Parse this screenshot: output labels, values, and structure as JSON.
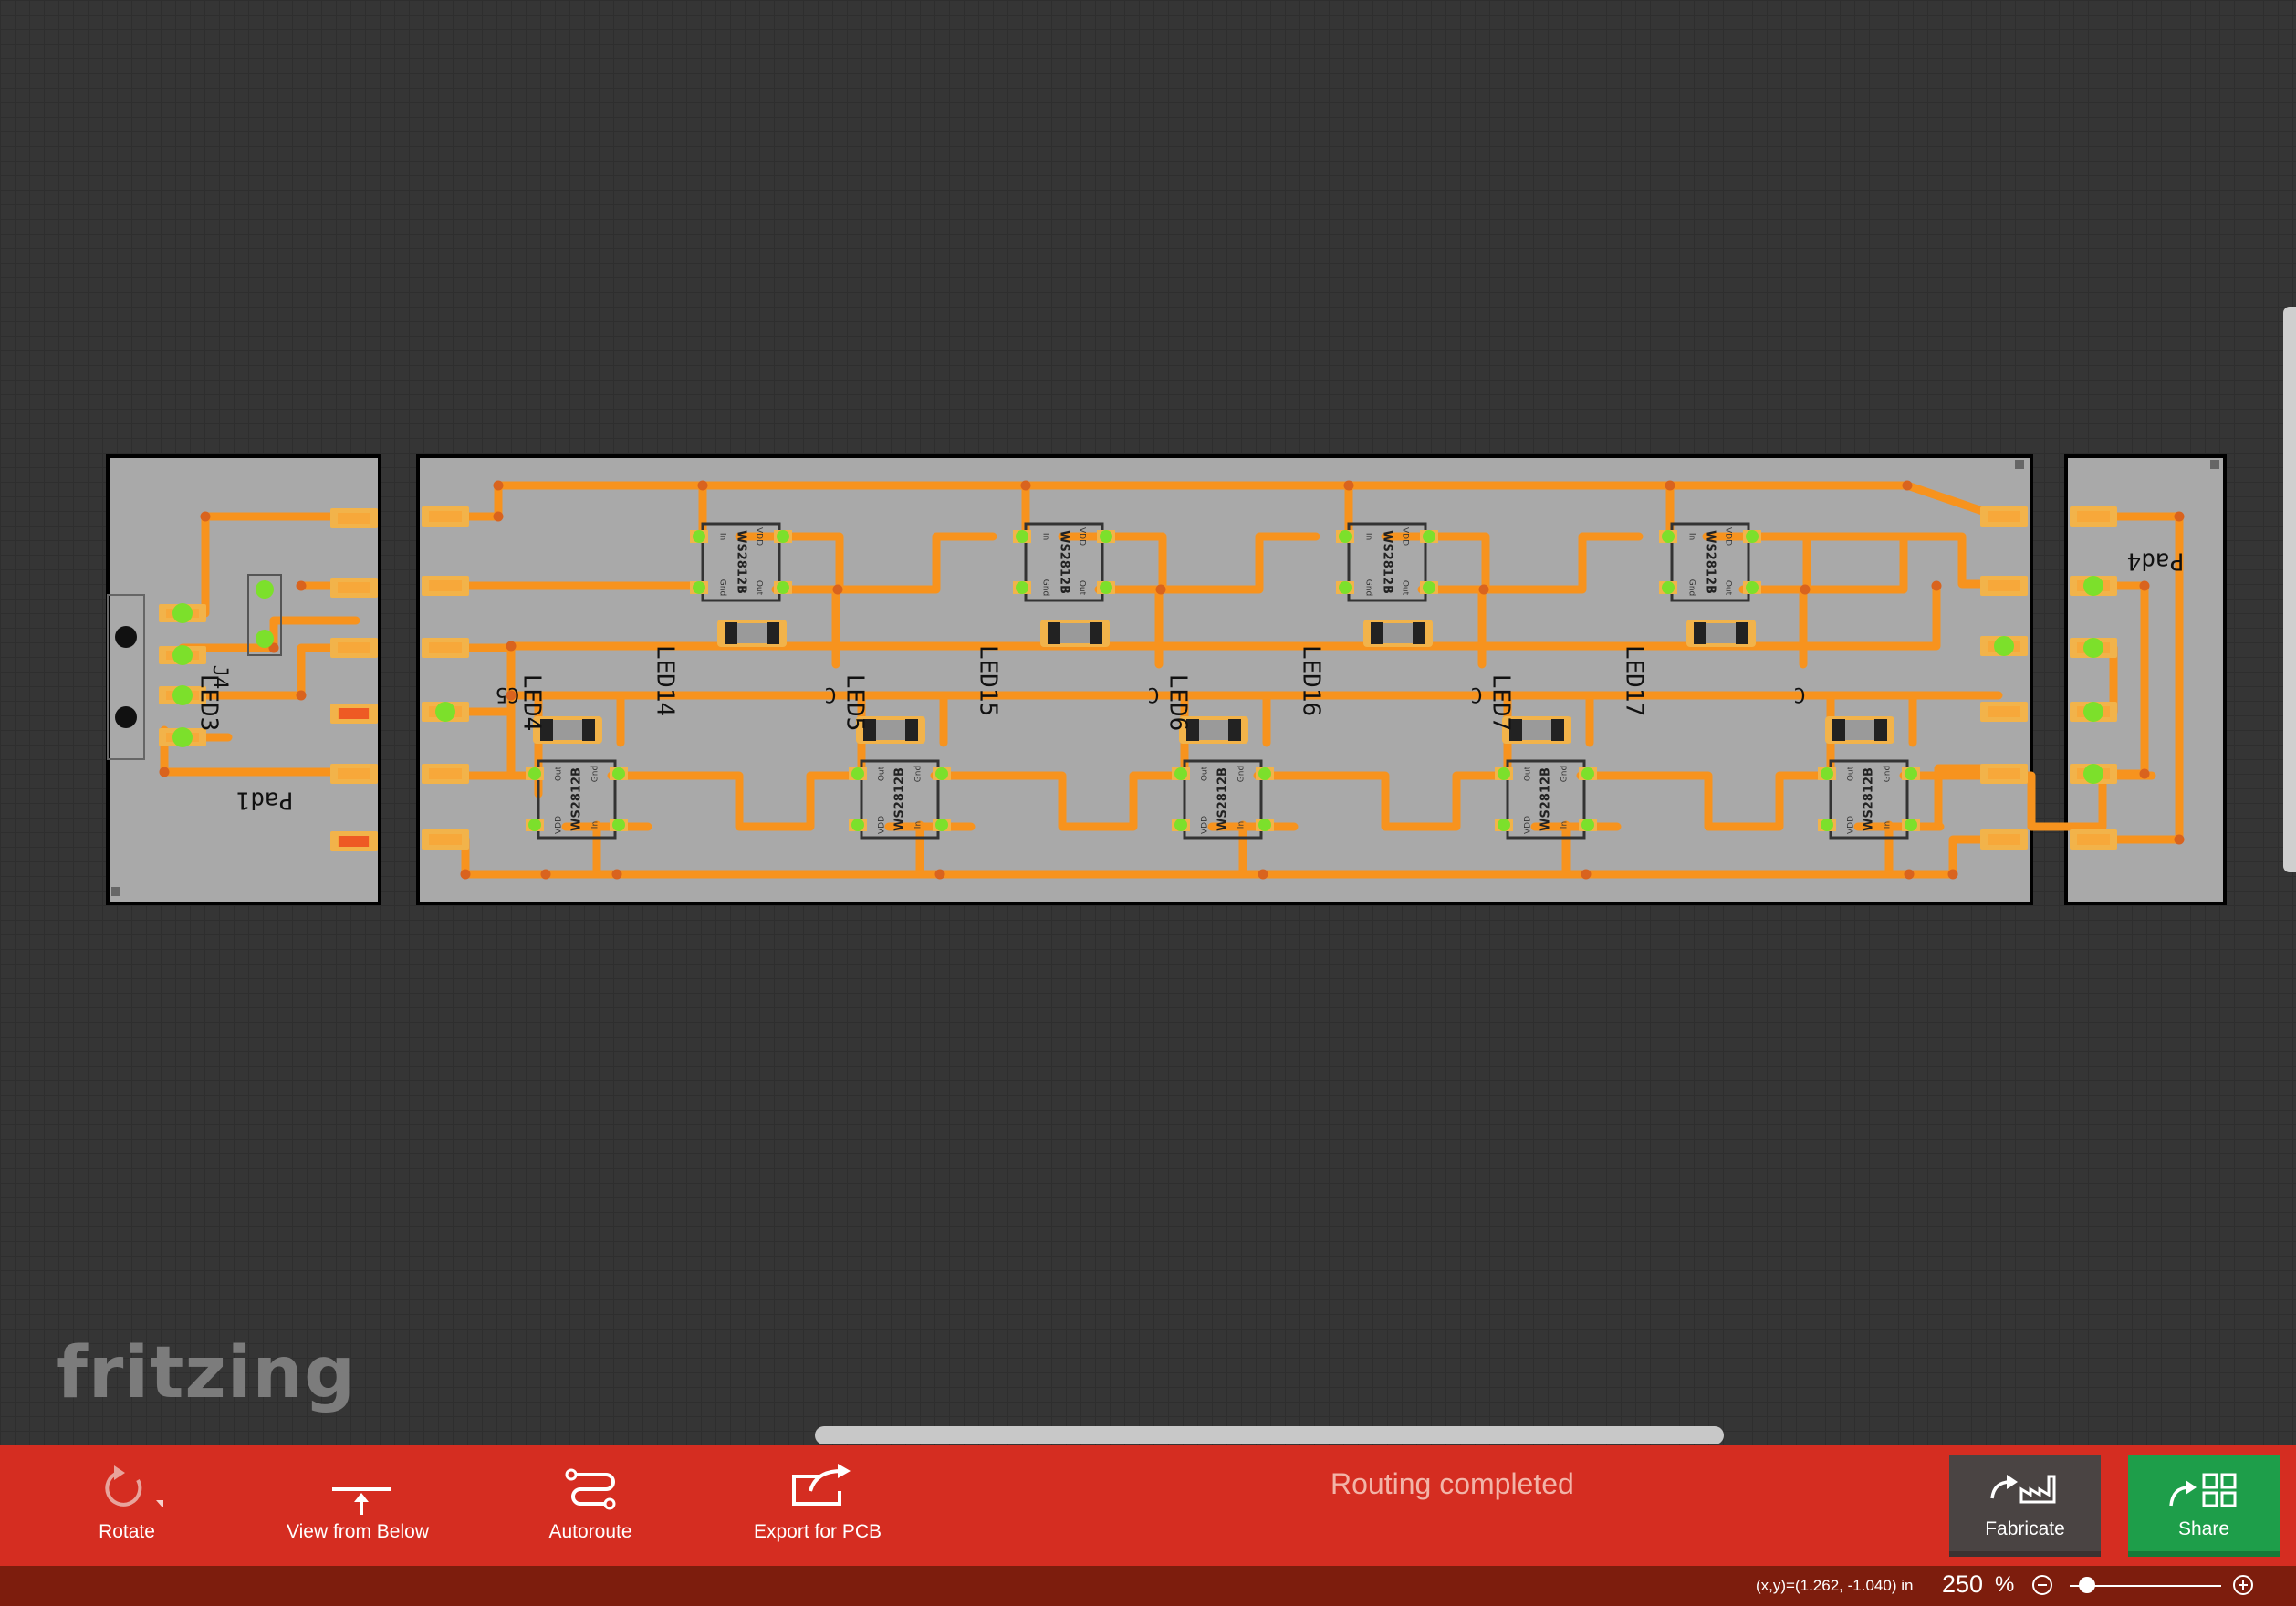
{
  "app": {
    "watermark": "fritzing"
  },
  "pcb": {
    "chip_label": "WS2812B",
    "pin_labels": {
      "out": "Out",
      "vdd": "VDD",
      "gnd": "Gnd",
      "in": "In"
    },
    "left_board": {
      "label": "Pad1",
      "sub_label": "J4"
    },
    "right_board": {
      "label": "Pad4"
    },
    "top_led_labels": [
      "LED14",
      "LED15",
      "LED16",
      "LED17"
    ],
    "bottom_led_labels": [
      "LED3",
      "LED4",
      "LED5",
      "LED6",
      "LED7"
    ],
    "ref_labels": [
      "C5",
      "C",
      "C",
      "C",
      "C"
    ],
    "colors": {
      "board": "#a9a9a9",
      "trace": "#f7931e",
      "pad": "#f2b34a",
      "highlight": "#7ce02b",
      "outline": "#000000"
    }
  },
  "toolbar": {
    "rotate": "Rotate",
    "view_from_below": "View from Below",
    "autoroute": "Autoroute",
    "export_pcb": "Export for PCB",
    "status": "Routing completed",
    "fabricate": "Fabricate",
    "share": "Share"
  },
  "statusbar": {
    "coords": "(x,y)=(1.262, -1.040) in",
    "zoom_value": "250",
    "zoom_unit": "%"
  }
}
